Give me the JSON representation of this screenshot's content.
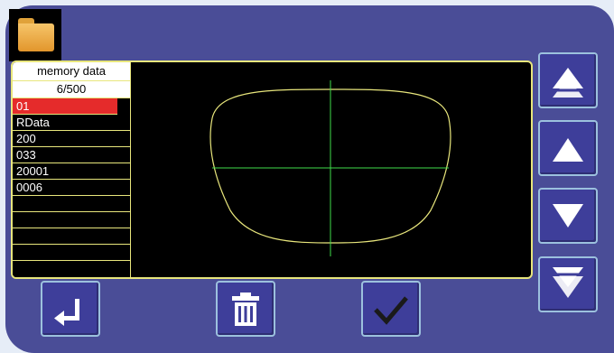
{
  "memory": {
    "header": "memory data",
    "count": "6/500",
    "rows": [
      "01",
      "RData",
      "200",
      "033",
      "20001",
      "0006",
      "",
      "",
      "",
      ""
    ]
  },
  "colors": {
    "panel": "#4a4d97",
    "frame_border": "#e8e67c",
    "selected_row": "#e52b2b",
    "shape_outline": "#e8e67c",
    "crosshair": "#3fdc4a"
  },
  "icons": {
    "folder": "folder-icon",
    "enter": "enter-return-icon",
    "delete": "trash-icon",
    "confirm": "checkmark-icon",
    "page_up": "double-up-arrow-icon",
    "up": "up-arrow-icon",
    "down": "down-arrow-icon",
    "page_down": "double-down-arrow-icon"
  }
}
